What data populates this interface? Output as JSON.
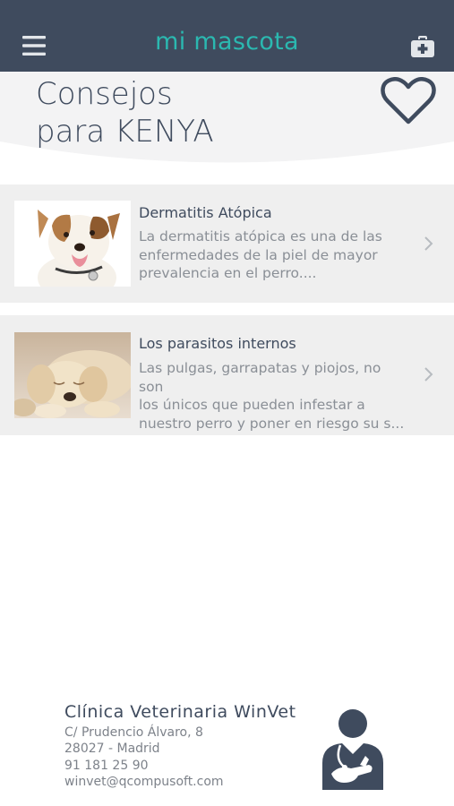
{
  "app": {
    "title": "mi mascota"
  },
  "header": {
    "title_line1": "Consejos",
    "title_line2": "para KENYA"
  },
  "icons": {
    "menu": "hamburger-menu-icon",
    "clinic": "first-aid-kit-icon",
    "favorite": "heart-outline-icon",
    "chevron": "chevron-right-icon",
    "vet": "veterinarian-icon"
  },
  "colors": {
    "topbar": "#3f4b5e",
    "accent": "#2bb8b0",
    "card_bg": "#efefef",
    "text_dark": "#3f4b5e",
    "text_muted": "#8a8f96"
  },
  "articles": [
    {
      "title": "Dermatitis Atópica",
      "line1": "La dermatitis atópica es una de las",
      "line2": "enfermedades de la piel de mayor",
      "line3": "prevalencia en el perro....",
      "image": "jack-russell-terrier-photo"
    },
    {
      "title": "Los parasitos internos",
      "line1": "Las pulgas, garrapatas y piojos, no son",
      "line2": "los únicos que pueden infestar a",
      "line3": "nuestro perro y poner en riesgo su s...",
      "image": "sleeping-golden-puppy-photo"
    }
  ],
  "footer": {
    "clinic_name": "Clínica Veterinaria WinVet",
    "address": "C/ Prudencio Álvaro, 8",
    "city": "28027 - Madrid",
    "phone": "91 181 25 90",
    "email": "winvet@qcompusoft.com"
  }
}
